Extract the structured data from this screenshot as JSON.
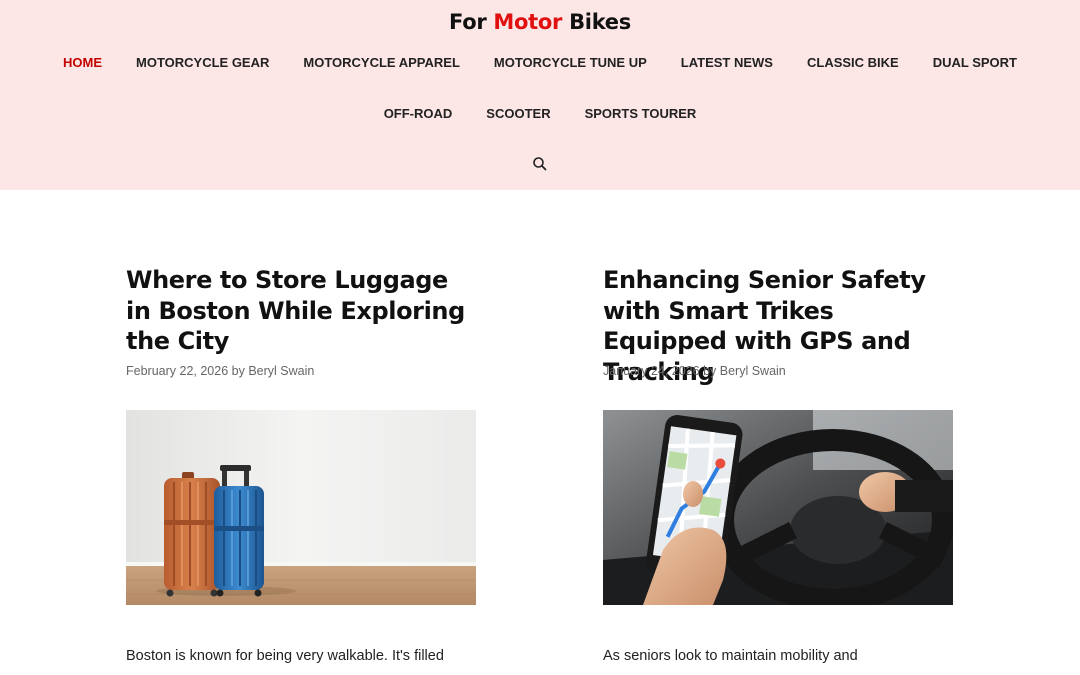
{
  "site": {
    "logo_part1": "For ",
    "logo_part2": "Motor",
    "logo_part3": " Bikes",
    "accent_color": "#e01010",
    "header_bg": "#fde6e6"
  },
  "nav": {
    "row1": [
      {
        "label": "HOME",
        "active": true
      },
      {
        "label": "MOTORCYCLE GEAR"
      },
      {
        "label": "MOTORCYCLE APPAREL"
      },
      {
        "label": "MOTORCYCLE TUNE UP"
      },
      {
        "label": "LATEST NEWS"
      },
      {
        "label": "CLASSIC BIKE"
      },
      {
        "label": "DUAL SPORT"
      }
    ],
    "row2": [
      {
        "label": "OFF-ROAD"
      },
      {
        "label": "SCOOTER"
      },
      {
        "label": "SPORTS TOURER"
      }
    ],
    "search_icon": "search-icon"
  },
  "posts": [
    {
      "title": "Where to Store Luggage in Boston While Exploring the City",
      "date": "February 22, 2026",
      "by": " by ",
      "author": "Beryl Swain",
      "image_icon": "luggage-photo",
      "excerpt": "Boston is known for being very walkable. It's filled"
    },
    {
      "title": "Enhancing Senior Safety with Smart Trikes Equipped with GPS and Tracking",
      "date": "January 24, 2026",
      "by": " by ",
      "author": "Beryl Swain",
      "image_icon": "gps-phone-driving-photo",
      "excerpt": "As seniors look to maintain mobility and"
    }
  ]
}
